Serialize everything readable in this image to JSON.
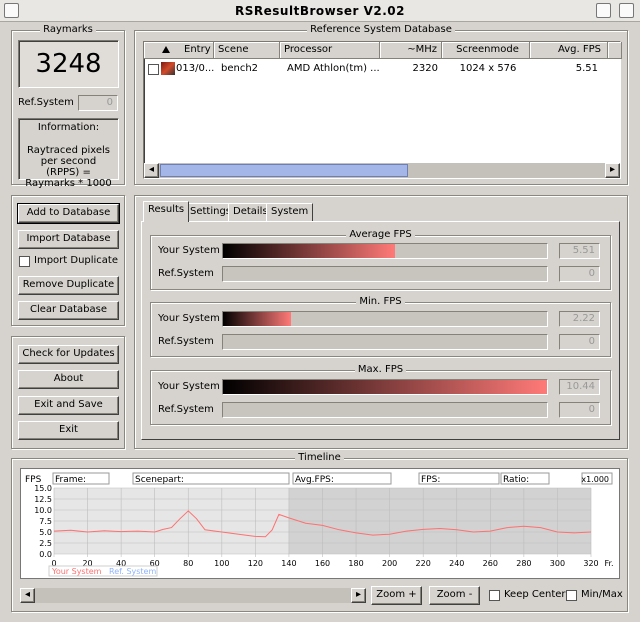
{
  "window": {
    "title": "RSResultBrowser V2.02"
  },
  "raymarks": {
    "title": "Raymarks",
    "score": "3248",
    "ref_label": "Ref.System",
    "ref_value": "0",
    "info_title": "Information:",
    "info_text": "Raytraced pixels per second (RPPS) = Raymarks * 1000"
  },
  "database": {
    "title": "Reference System Database",
    "columns": [
      "Entry",
      "Scene",
      "Processor",
      "~MHz",
      "Screenmode",
      "Avg. FPS"
    ],
    "rows": [
      {
        "entry": "013/0...",
        "scene": "bench2",
        "processor": "AMD Athlon(tm) ...",
        "mhz": "2320",
        "screenmode": "1024 x  576",
        "avg_fps": "5.51"
      }
    ]
  },
  "actions": {
    "add": "Add to Database",
    "import": "Import Database",
    "import_duplicate": "Import Duplicate",
    "remove_duplicate": "Remove Duplicate",
    "clear": "Clear Database",
    "check_updates": "Check for Updates",
    "about": "About",
    "exit_save": "Exit and Save",
    "exit": "Exit"
  },
  "tabs": [
    "Results",
    "Settings",
    "Details",
    "System"
  ],
  "results": {
    "your_label": "Your System",
    "ref_label": "Ref.System",
    "groups": [
      {
        "title": "Average FPS",
        "your_value": "5.51",
        "your_fraction": 0.53,
        "ref_value": "0"
      },
      {
        "title": "Min. FPS",
        "your_value": "2.22",
        "your_fraction": 0.21,
        "ref_value": "0"
      },
      {
        "title": "Max. FPS",
        "your_value": "10.44",
        "your_fraction": 1.0,
        "ref_value": "0"
      }
    ]
  },
  "timeline": {
    "title": "Timeline",
    "fps_label": "FPS",
    "frame_label": "Frame:",
    "scenepart_label": "Scenepart:",
    "avg_label": "Avg.FPS:",
    "fps_field_label": "FPS:",
    "ratio_label": "Ratio:",
    "zoom_level": "x1.000",
    "legend_your": "Your System",
    "legend_ref": "Ref. System",
    "zoom_in": "Zoom +",
    "zoom_out": "Zoom -",
    "keep_center": "Keep Center",
    "minmax": "Min/Max",
    "x_unit": "Fr."
  },
  "chart_data": {
    "type": "line",
    "xlabel": "Fr.",
    "ylabel": "FPS",
    "xlim": [
      0,
      320
    ],
    "ylim": [
      0,
      15
    ],
    "x_ticks": [
      0,
      20,
      40,
      60,
      80,
      100,
      120,
      140,
      160,
      180,
      200,
      220,
      240,
      260,
      280,
      300,
      320
    ],
    "y_ticks": [
      "0.0",
      "2.5",
      "5.0",
      "7.5",
      "10.0",
      "12.5",
      "15.0"
    ],
    "shaded_x": [
      140,
      320
    ],
    "series": [
      {
        "name": "Your System",
        "color": "#ff7070",
        "points": [
          [
            0,
            5.2
          ],
          [
            10,
            5.4
          ],
          [
            20,
            5.0
          ],
          [
            30,
            5.3
          ],
          [
            40,
            5.1
          ],
          [
            50,
            5.2
          ],
          [
            60,
            5.0
          ],
          [
            65,
            5.6
          ],
          [
            70,
            6.0
          ],
          [
            75,
            8.0
          ],
          [
            80,
            9.8
          ],
          [
            85,
            8.0
          ],
          [
            90,
            5.5
          ],
          [
            100,
            5.0
          ],
          [
            110,
            4.5
          ],
          [
            120,
            4.0
          ],
          [
            126,
            3.9
          ],
          [
            130,
            5.5
          ],
          [
            134,
            9.0
          ],
          [
            140,
            8.2
          ],
          [
            150,
            7.0
          ],
          [
            160,
            6.5
          ],
          [
            170,
            5.5
          ],
          [
            180,
            4.8
          ],
          [
            190,
            4.3
          ],
          [
            200,
            4.5
          ],
          [
            210,
            5.2
          ],
          [
            220,
            5.6
          ],
          [
            230,
            5.8
          ],
          [
            240,
            5.5
          ],
          [
            250,
            5.0
          ],
          [
            260,
            5.2
          ],
          [
            270,
            6.0
          ],
          [
            280,
            6.3
          ],
          [
            290,
            6.0
          ],
          [
            300,
            5.0
          ],
          [
            310,
            4.8
          ],
          [
            320,
            5.0
          ]
        ]
      },
      {
        "name": "Ref. System",
        "color": "#8fb3ff",
        "points": []
      }
    ]
  }
}
